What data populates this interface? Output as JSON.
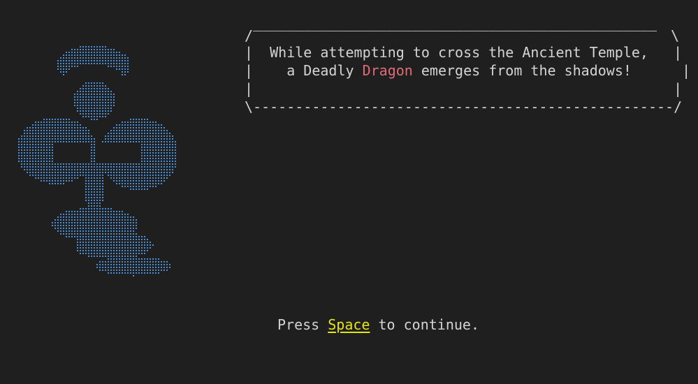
{
  "art": {
    "name": "ghost-sprite",
    "color": "#4a8fd6"
  },
  "narration": {
    "border_top": " ________________________________________________",
    "border_left_top": "/",
    "border_right_top": "\\",
    "line1_prefix": "|  While attempting to cross the Ancient Temple,   |",
    "line2_before": "|    a Deadly ",
    "line2_enemy": "Dragon",
    "line2_after": " emerges from the shadows!      |",
    "line3": "|                                                  |",
    "border_bottom": "\\--------------------------------------------------/",
    "enemy_color": "#e06c75"
  },
  "prompt": {
    "before": "Press ",
    "key": "Space",
    "after": " to continue.",
    "key_color": "#e5e510"
  }
}
